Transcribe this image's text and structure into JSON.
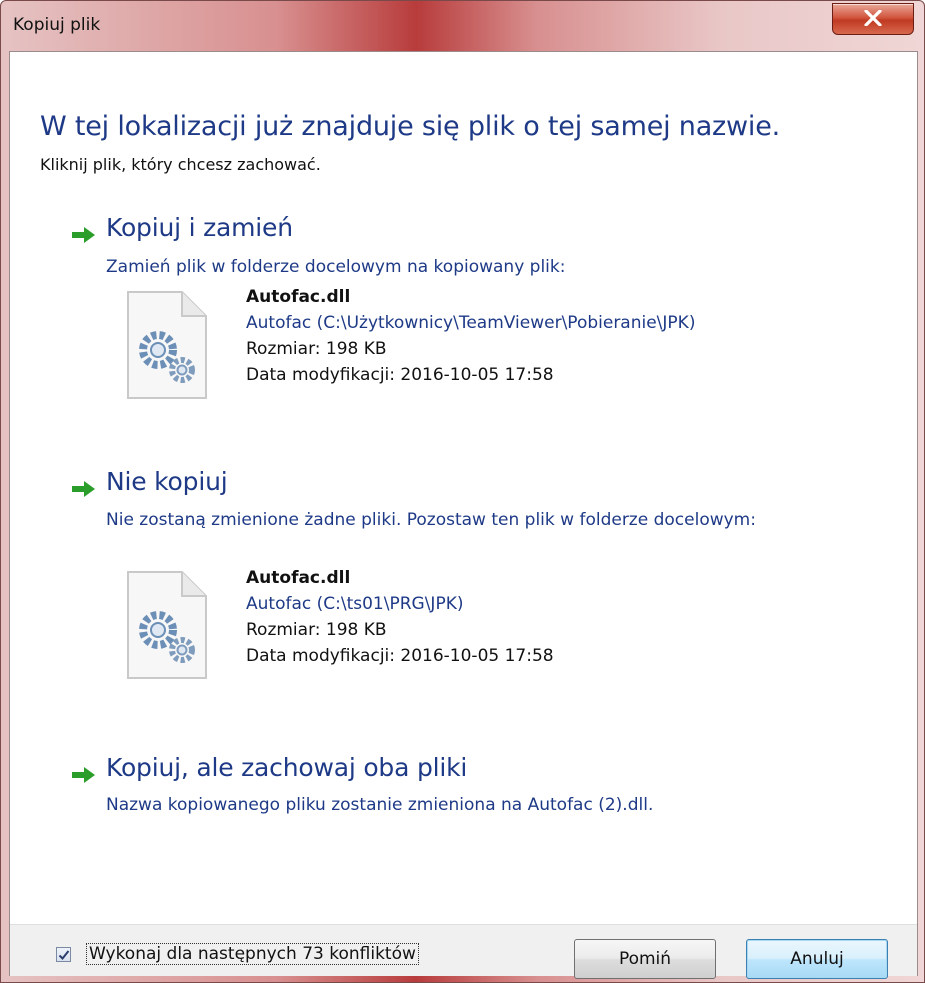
{
  "window": {
    "title": "Kopiuj plik"
  },
  "dialog": {
    "heading": "W tej lokalizacji już znajduje się plik o tej samej nazwie.",
    "subheading": "Kliknij plik, który chcesz zachować."
  },
  "options": [
    {
      "title": "Kopiuj i zamień",
      "description": "Zamień plik w folderze docelowym na kopiowany plik:",
      "file": {
        "name": "Autofac.dll",
        "path": "Autofac (C:\\Użytkownicy\\TeamViewer\\Pobieranie\\JPK)",
        "size": "Rozmiar: 198 KB",
        "modified": "Data modyfikacji: 2016-10-05 17:58"
      }
    },
    {
      "title": "Nie kopiuj",
      "description": "Nie zostaną zmienione żadne pliki. Pozostaw ten plik w folderze docelowym:",
      "file": {
        "name": "Autofac.dll",
        "path": "Autofac (C:\\ts01\\PRG\\JPK)",
        "size": "Rozmiar: 198 KB",
        "modified": "Data modyfikacji: 2016-10-05 17:58"
      }
    },
    {
      "title": "Kopiuj, ale zachowaj oba pliki",
      "description": "Nazwa kopiowanego pliku zostanie zmieniona na Autofac (2).dll."
    }
  ],
  "footer": {
    "checkbox_label": "Wykonaj dla następnych 73 konfliktów",
    "checkbox_checked": true,
    "skip_label": "Pomiń",
    "cancel_label": "Anuluj"
  },
  "icons": {
    "arrow": "green-arrow-icon",
    "file": "dll-gear-file-icon",
    "close": "close-icon"
  },
  "colors": {
    "link_blue": "#1e3a87",
    "arrow_green": "#2a9d2a",
    "close_red": "#c03a22"
  }
}
